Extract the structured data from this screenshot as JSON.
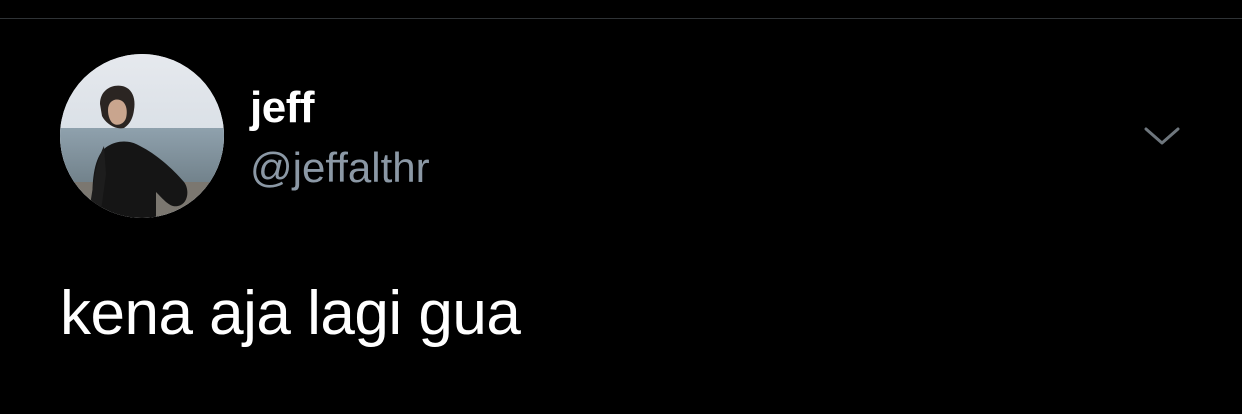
{
  "tweet": {
    "author": {
      "display_name": "jeff",
      "handle": "@jeffalthr",
      "avatar_icon": "profile-photo"
    },
    "text": "kena aja lagi gua",
    "menu_icon": "chevron-down-icon"
  },
  "theme": {
    "background": "#000000",
    "text_primary": "#ffffff",
    "text_secondary": "#8b98a5",
    "divider": "#2f3336"
  }
}
